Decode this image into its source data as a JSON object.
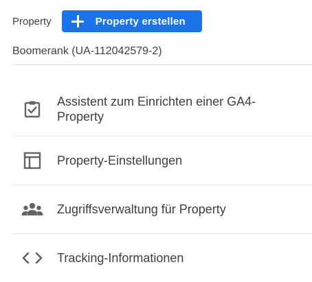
{
  "header": {
    "label": "Property",
    "create_button_label": "Property erstellen"
  },
  "property": {
    "name": "Boomerank (UA-112042579-2)"
  },
  "menu": {
    "items": [
      {
        "label": "Assistent zum Einrichten einer GA4-Property",
        "icon": "clipboard-check-icon",
        "highlighted": true
      },
      {
        "label": "Property-Einstellungen",
        "icon": "window-layout-icon"
      },
      {
        "label": "Zugriffsverwaltung für Property",
        "icon": "people-group-icon"
      },
      {
        "label": "Tracking-Informationen",
        "icon": "code-brackets-icon"
      }
    ]
  },
  "colors": {
    "primary_button": "#1a73e8",
    "highlight": "#fbfb1e",
    "text": "#3c4043",
    "icon": "#5f6368",
    "divider": "#dadce0"
  }
}
